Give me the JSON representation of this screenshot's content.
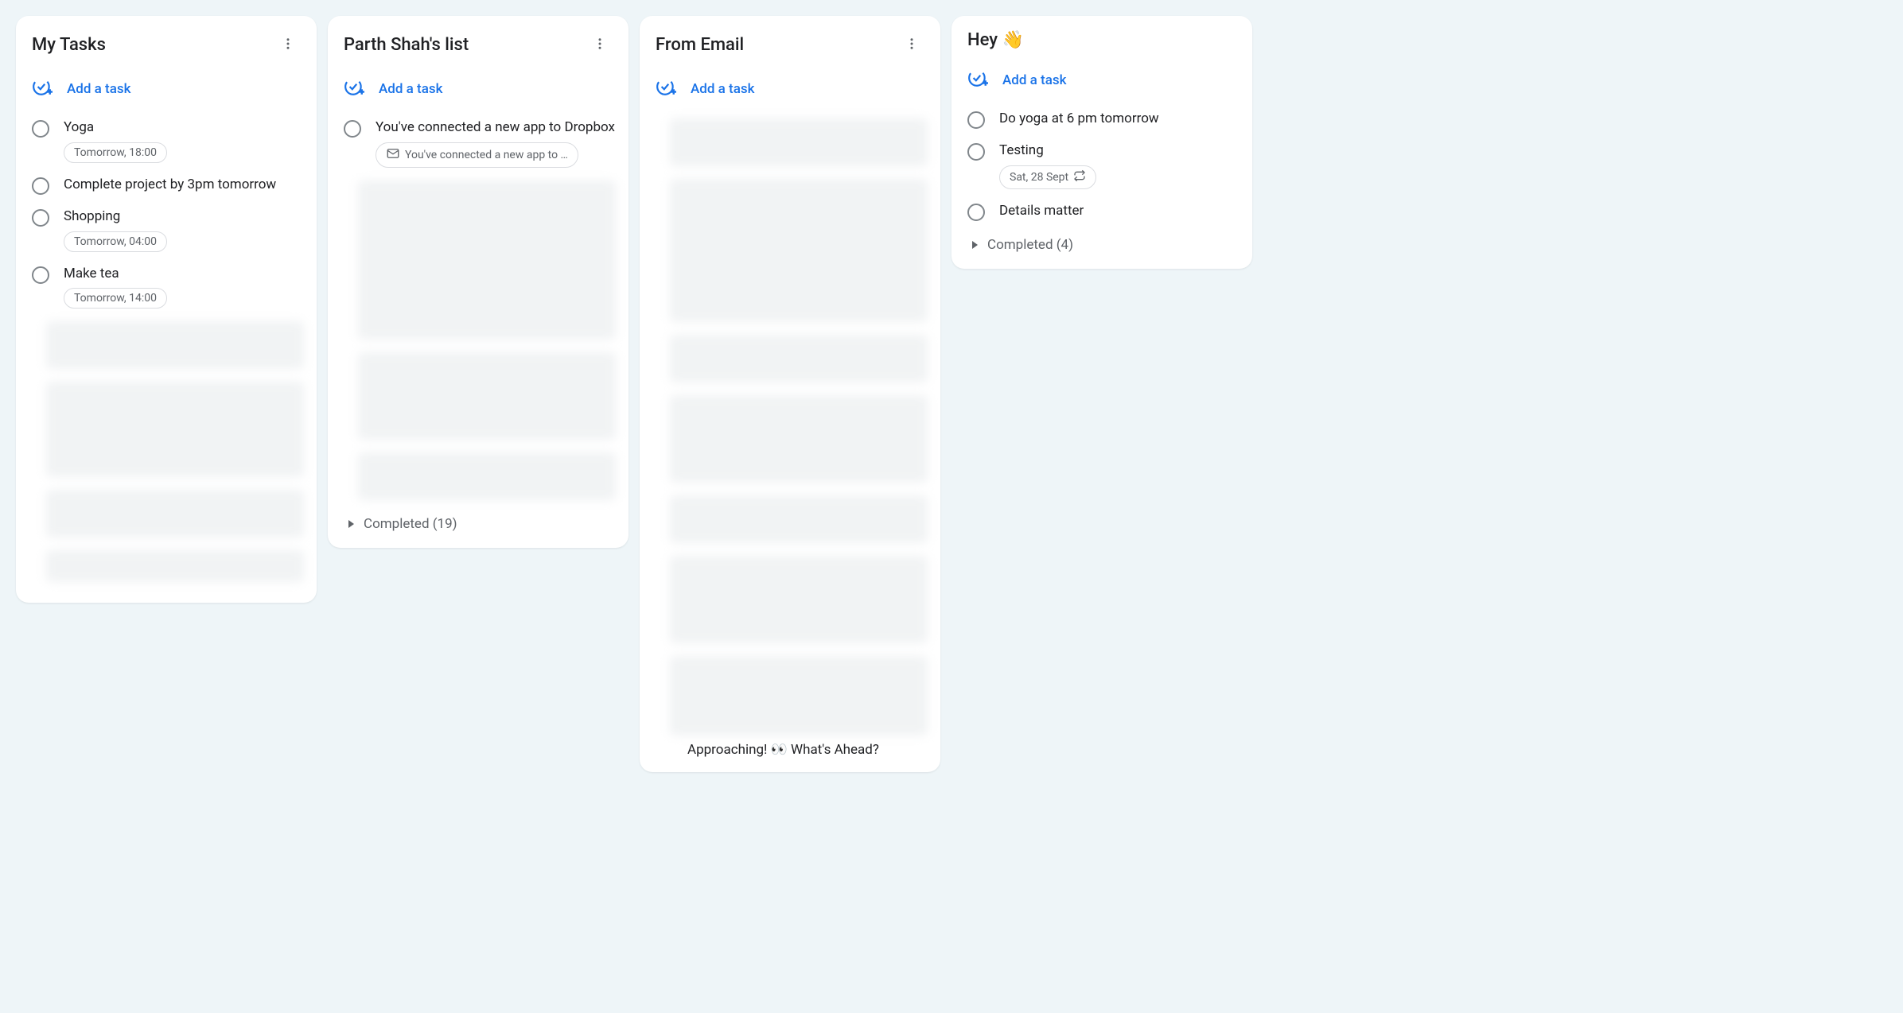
{
  "add_label": "Add a task",
  "lists": [
    {
      "title": "My Tasks",
      "show_more": true,
      "tasks": [
        {
          "title": "Yoga",
          "date": "Tomorrow, 18:00"
        },
        {
          "title": "Complete project by 3pm tomorrow"
        },
        {
          "title": "Shopping",
          "date": "Tomorrow, 04:00"
        },
        {
          "title": "Make tea",
          "date": "Tomorrow, 14:00"
        }
      ],
      "blurred_count": 4,
      "blur_heights": [
        60,
        120,
        60,
        40
      ]
    },
    {
      "title": "Parth Shah's list",
      "show_more": true,
      "tasks": [
        {
          "title": "You've connected a new app to Dropbox",
          "email": "You've connected a new app to …"
        }
      ],
      "blurred_count": 3,
      "blur_heights": [
        200,
        110,
        60
      ],
      "completed": "Completed (19)"
    },
    {
      "title": "From Email",
      "show_more": true,
      "tasks": [],
      "blurred_count": 7,
      "blur_heights": [
        60,
        180,
        60,
        110,
        60,
        110,
        100
      ],
      "trailing_text": "Approaching! 👀 What's Ahead?"
    },
    {
      "title": "Hey 👋",
      "show_more": false,
      "tasks": [
        {
          "title": "Do yoga at 6 pm tomorrow"
        },
        {
          "title": "Testing",
          "date": "Sat, 28 Sept",
          "repeat": true
        },
        {
          "title": "Details matter"
        }
      ],
      "blurred_count": 0,
      "completed": "Completed (4)"
    }
  ]
}
